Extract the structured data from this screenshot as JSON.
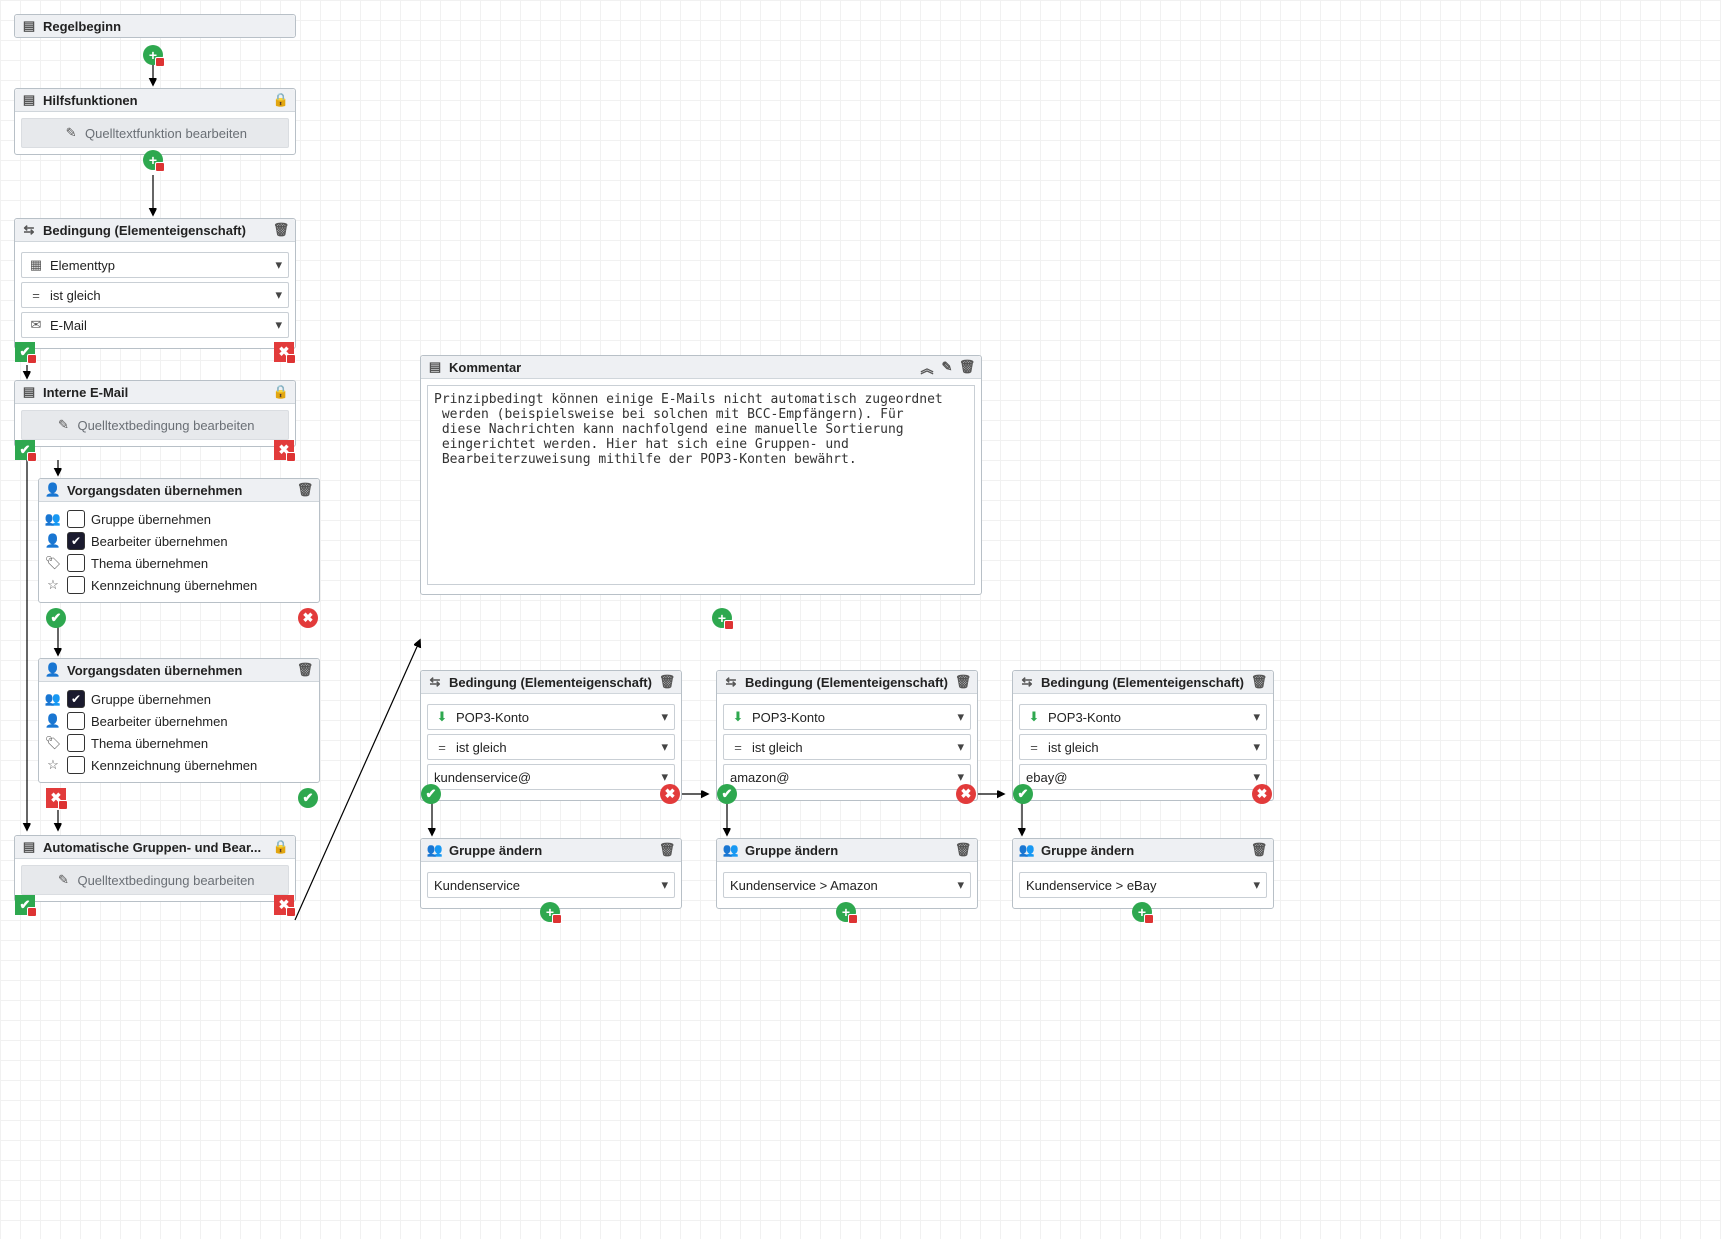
{
  "start": {
    "title": "Regelbeginn"
  },
  "helpers": {
    "title": "Hilfsfunktionen",
    "button": "Quelltextfunktion bearbeiten"
  },
  "cond_email": {
    "title": "Bedingung (Elementeigenschaft)",
    "field1": "Elementtyp",
    "op": "ist gleich",
    "value": "E-Mail"
  },
  "internal_email": {
    "title": "Interne E-Mail",
    "button": "Quelltextbedingung bearbeiten"
  },
  "vorgang1": {
    "title": "Vorgangsdaten übernehmen",
    "c1": "Gruppe übernehmen",
    "c2": "Bearbeiter übernehmen",
    "c3": "Thema übernehmen",
    "c4": "Kennzeichnung übernehmen"
  },
  "vorgang2": {
    "title": "Vorgangsdaten übernehmen",
    "c1": "Gruppe übernehmen",
    "c2": "Bearbeiter übernehmen",
    "c3": "Thema übernehmen",
    "c4": "Kennzeichnung übernehmen"
  },
  "vorgang1_state": {
    "c1": false,
    "c2": true,
    "c3": false,
    "c4": false
  },
  "vorgang2_state": {
    "c1": true,
    "c2": false,
    "c3": false,
    "c4": false
  },
  "auto_group": {
    "title": "Automatische Gruppen- und Bear...",
    "button": "Quelltextbedingung bearbeiten"
  },
  "comment": {
    "title": "Kommentar",
    "text": "Prinzipbedingt können einige E-Mails nicht automatisch zugeordnet\n werden (beispielsweise bei solchen mit BCC-Empfängern). Für\n diese Nachrichten kann nachfolgend eine manuelle Sortierung\n eingerichtet werden. Hier hat sich eine Gruppen- und\n Bearbeiterzuweisung mithilfe der POP3-Konten bewährt."
  },
  "cond_a": {
    "title": "Bedingung (Elementeigenschaft)",
    "field": "POP3-Konto",
    "op": "ist gleich",
    "value": "kundenservice@"
  },
  "cond_b": {
    "title": "Bedingung (Elementeigenschaft)",
    "field": "POP3-Konto",
    "op": "ist gleich",
    "value": "amazon@"
  },
  "cond_c": {
    "title": "Bedingung (Elementeigenschaft)",
    "field": "POP3-Konto",
    "op": "ist gleich",
    "value": "ebay@"
  },
  "grp_a": {
    "title": "Gruppe ändern",
    "value": "Kundenservice"
  },
  "grp_b": {
    "title": "Gruppe ändern",
    "value": "Kundenservice > Amazon"
  },
  "grp_c": {
    "title": "Gruppe ändern",
    "value": "Kundenservice > eBay"
  }
}
